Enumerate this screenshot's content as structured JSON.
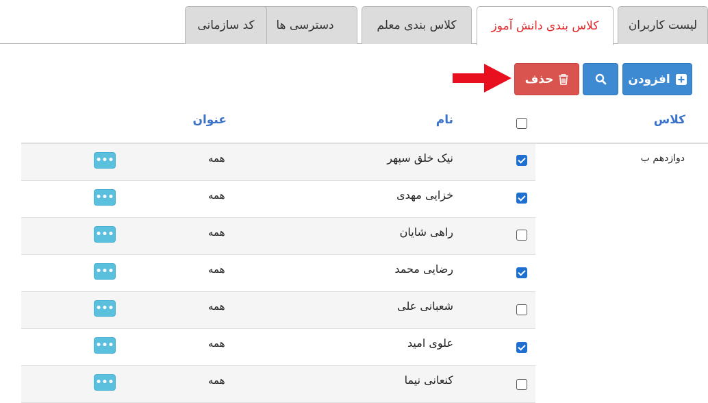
{
  "tabs": [
    {
      "label": "لیست کاربران",
      "active": false
    },
    {
      "label": "کلاس بندی دانش آموز",
      "active": true
    },
    {
      "label": "کلاس بندی معلم",
      "active": false
    },
    {
      "label": "دسترسی ها",
      "active": false
    },
    {
      "label": "کد سازمانی",
      "active": false
    }
  ],
  "toolbar": {
    "add_label": "افزودن",
    "delete_label": "حذف"
  },
  "table": {
    "headers": {
      "class": "کلاس",
      "name": "نام",
      "title": "عنوان"
    },
    "select_all_checked": false,
    "class_value": "دوازدهم ب",
    "rows": [
      {
        "name": "نیک خلق سپهر",
        "title": "همه",
        "checked": true
      },
      {
        "name": "خزایی مهدی",
        "title": "همه",
        "checked": true
      },
      {
        "name": "راهی شایان",
        "title": "همه",
        "checked": false
      },
      {
        "name": "رضایی محمد",
        "title": "همه",
        "checked": true
      },
      {
        "name": "شعبانی علی",
        "title": "همه",
        "checked": false
      },
      {
        "name": "علوی امید",
        "title": "همه",
        "checked": true
      },
      {
        "name": "کنعانی نیما",
        "title": "همه",
        "checked": false
      }
    ]
  },
  "colors": {
    "active_tab_text": "#e0292c",
    "primary_button": "#3d8ad2",
    "danger_button": "#d9534f",
    "header_text": "#3a73c9",
    "menu_button": "#5bc0de",
    "arrow": "#e8101e"
  }
}
